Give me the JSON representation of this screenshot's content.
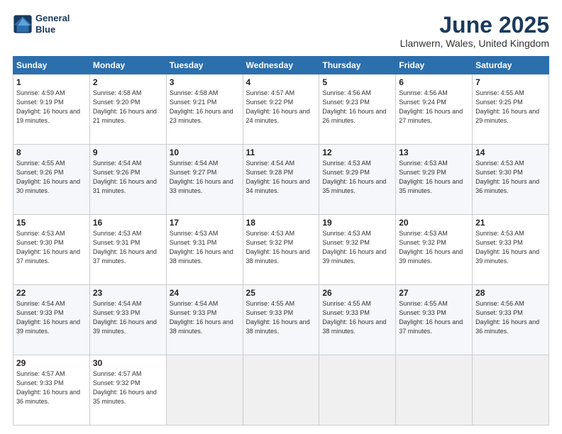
{
  "header": {
    "logo_line1": "General",
    "logo_line2": "Blue",
    "month_title": "June 2025",
    "location": "Llanwern, Wales, United Kingdom"
  },
  "weekdays": [
    "Sunday",
    "Monday",
    "Tuesday",
    "Wednesday",
    "Thursday",
    "Friday",
    "Saturday"
  ],
  "weeks": [
    [
      {
        "day": "1",
        "sunrise": "Sunrise: 4:59 AM",
        "sunset": "Sunset: 9:19 PM",
        "daylight": "Daylight: 16 hours and 19 minutes."
      },
      {
        "day": "2",
        "sunrise": "Sunrise: 4:58 AM",
        "sunset": "Sunset: 9:20 PM",
        "daylight": "Daylight: 16 hours and 21 minutes."
      },
      {
        "day": "3",
        "sunrise": "Sunrise: 4:58 AM",
        "sunset": "Sunset: 9:21 PM",
        "daylight": "Daylight: 16 hours and 23 minutes."
      },
      {
        "day": "4",
        "sunrise": "Sunrise: 4:57 AM",
        "sunset": "Sunset: 9:22 PM",
        "daylight": "Daylight: 16 hours and 24 minutes."
      },
      {
        "day": "5",
        "sunrise": "Sunrise: 4:56 AM",
        "sunset": "Sunset: 9:23 PM",
        "daylight": "Daylight: 16 hours and 26 minutes."
      },
      {
        "day": "6",
        "sunrise": "Sunrise: 4:56 AM",
        "sunset": "Sunset: 9:24 PM",
        "daylight": "Daylight: 16 hours and 27 minutes."
      },
      {
        "day": "7",
        "sunrise": "Sunrise: 4:55 AM",
        "sunset": "Sunset: 9:25 PM",
        "daylight": "Daylight: 16 hours and 29 minutes."
      }
    ],
    [
      {
        "day": "8",
        "sunrise": "Sunrise: 4:55 AM",
        "sunset": "Sunset: 9:26 PM",
        "daylight": "Daylight: 16 hours and 30 minutes."
      },
      {
        "day": "9",
        "sunrise": "Sunrise: 4:54 AM",
        "sunset": "Sunset: 9:26 PM",
        "daylight": "Daylight: 16 hours and 31 minutes."
      },
      {
        "day": "10",
        "sunrise": "Sunrise: 4:54 AM",
        "sunset": "Sunset: 9:27 PM",
        "daylight": "Daylight: 16 hours and 33 minutes."
      },
      {
        "day": "11",
        "sunrise": "Sunrise: 4:54 AM",
        "sunset": "Sunset: 9:28 PM",
        "daylight": "Daylight: 16 hours and 34 minutes."
      },
      {
        "day": "12",
        "sunrise": "Sunrise: 4:53 AM",
        "sunset": "Sunset: 9:29 PM",
        "daylight": "Daylight: 16 hours and 35 minutes."
      },
      {
        "day": "13",
        "sunrise": "Sunrise: 4:53 AM",
        "sunset": "Sunset: 9:29 PM",
        "daylight": "Daylight: 16 hours and 35 minutes."
      },
      {
        "day": "14",
        "sunrise": "Sunrise: 4:53 AM",
        "sunset": "Sunset: 9:30 PM",
        "daylight": "Daylight: 16 hours and 36 minutes."
      }
    ],
    [
      {
        "day": "15",
        "sunrise": "Sunrise: 4:53 AM",
        "sunset": "Sunset: 9:30 PM",
        "daylight": "Daylight: 16 hours and 37 minutes."
      },
      {
        "day": "16",
        "sunrise": "Sunrise: 4:53 AM",
        "sunset": "Sunset: 9:31 PM",
        "daylight": "Daylight: 16 hours and 37 minutes."
      },
      {
        "day": "17",
        "sunrise": "Sunrise: 4:53 AM",
        "sunset": "Sunset: 9:31 PM",
        "daylight": "Daylight: 16 hours and 38 minutes."
      },
      {
        "day": "18",
        "sunrise": "Sunrise: 4:53 AM",
        "sunset": "Sunset: 9:32 PM",
        "daylight": "Daylight: 16 hours and 38 minutes."
      },
      {
        "day": "19",
        "sunrise": "Sunrise: 4:53 AM",
        "sunset": "Sunset: 9:32 PM",
        "daylight": "Daylight: 16 hours and 39 minutes."
      },
      {
        "day": "20",
        "sunrise": "Sunrise: 4:53 AM",
        "sunset": "Sunset: 9:32 PM",
        "daylight": "Daylight: 16 hours and 39 minutes."
      },
      {
        "day": "21",
        "sunrise": "Sunrise: 4:53 AM",
        "sunset": "Sunset: 9:33 PM",
        "daylight": "Daylight: 16 hours and 39 minutes."
      }
    ],
    [
      {
        "day": "22",
        "sunrise": "Sunrise: 4:54 AM",
        "sunset": "Sunset: 9:33 PM",
        "daylight": "Daylight: 16 hours and 39 minutes."
      },
      {
        "day": "23",
        "sunrise": "Sunrise: 4:54 AM",
        "sunset": "Sunset: 9:33 PM",
        "daylight": "Daylight: 16 hours and 39 minutes."
      },
      {
        "day": "24",
        "sunrise": "Sunrise: 4:54 AM",
        "sunset": "Sunset: 9:33 PM",
        "daylight": "Daylight: 16 hours and 38 minutes."
      },
      {
        "day": "25",
        "sunrise": "Sunrise: 4:55 AM",
        "sunset": "Sunset: 9:33 PM",
        "daylight": "Daylight: 16 hours and 38 minutes."
      },
      {
        "day": "26",
        "sunrise": "Sunrise: 4:55 AM",
        "sunset": "Sunset: 9:33 PM",
        "daylight": "Daylight: 16 hours and 38 minutes."
      },
      {
        "day": "27",
        "sunrise": "Sunrise: 4:55 AM",
        "sunset": "Sunset: 9:33 PM",
        "daylight": "Daylight: 16 hours and 37 minutes."
      },
      {
        "day": "28",
        "sunrise": "Sunrise: 4:56 AM",
        "sunset": "Sunset: 9:33 PM",
        "daylight": "Daylight: 16 hours and 36 minutes."
      }
    ],
    [
      {
        "day": "29",
        "sunrise": "Sunrise: 4:57 AM",
        "sunset": "Sunset: 9:33 PM",
        "daylight": "Daylight: 16 hours and 36 minutes."
      },
      {
        "day": "30",
        "sunrise": "Sunrise: 4:57 AM",
        "sunset": "Sunset: 9:32 PM",
        "daylight": "Daylight: 16 hours and 35 minutes."
      },
      null,
      null,
      null,
      null,
      null
    ]
  ]
}
